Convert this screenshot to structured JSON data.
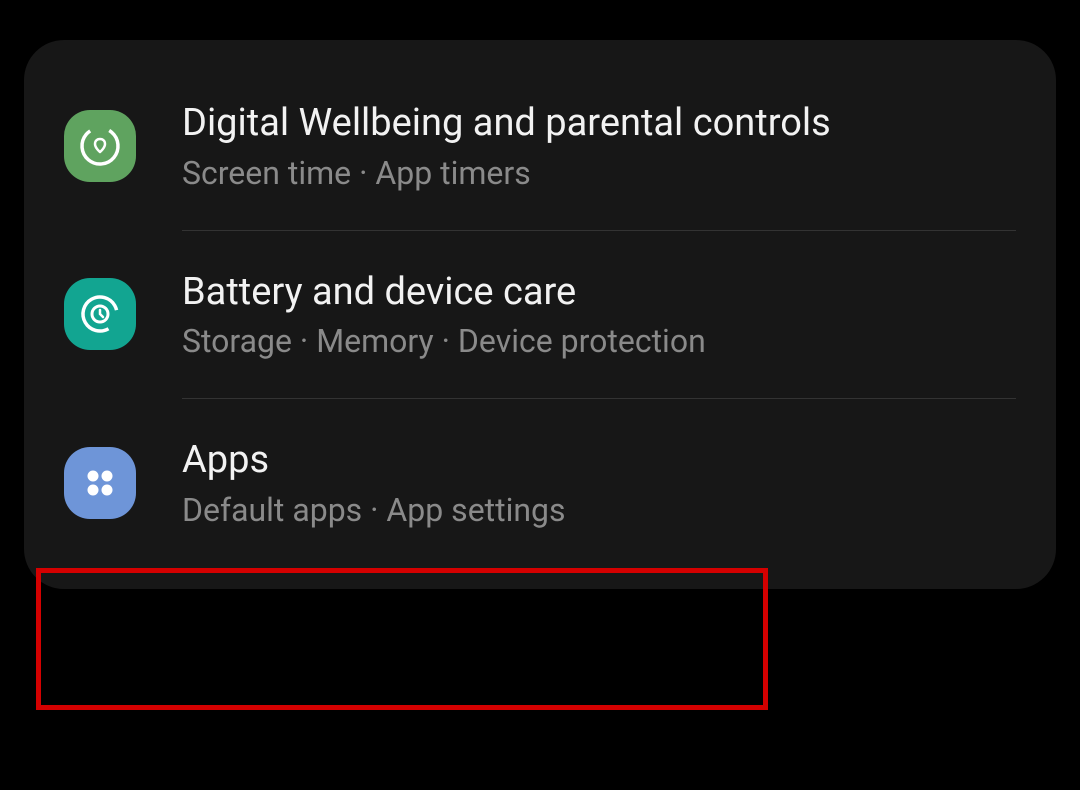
{
  "items": [
    {
      "title": "Digital Wellbeing and parental controls",
      "subtitle": "Screen time  ·  App timers"
    },
    {
      "title": "Battery and device care",
      "subtitle": "Storage  ·  Memory  ·  Device protection"
    },
    {
      "title": "Apps",
      "subtitle": "Default apps  ·  App settings"
    }
  ]
}
